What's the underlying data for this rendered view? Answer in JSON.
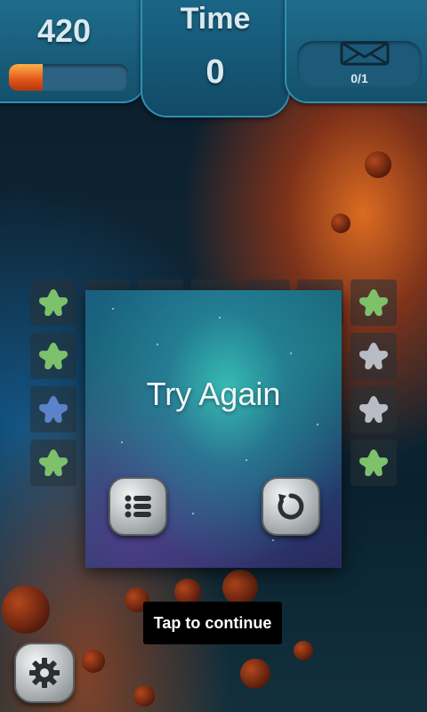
{
  "hud": {
    "score": "420",
    "score_progress_fraction": 0.28,
    "time_label": "Time",
    "time_value": "0",
    "moves_count": "0/1",
    "moves_icon": "envelope-icon"
  },
  "dialog": {
    "title": "Try Again",
    "menu_icon": "list-icon",
    "retry_icon": "restart-icon"
  },
  "overlay": {
    "tap_to_continue": "Tap to continue"
  },
  "settings_icon": "gear-icon",
  "board": {
    "left_column_colors": [
      "green",
      "green",
      "blue",
      "green"
    ],
    "right_column_colors": [
      "green",
      "gray",
      "gray",
      "green"
    ],
    "colors": {
      "green": "#7dc26a",
      "blue": "#5b83c9",
      "gray": "#b9bcc4"
    }
  }
}
